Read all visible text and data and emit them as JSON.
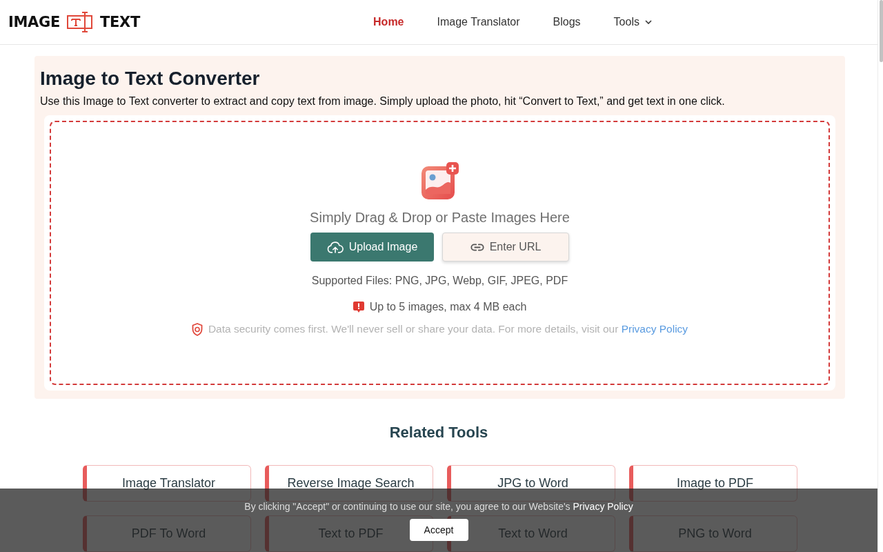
{
  "header": {
    "logo": {
      "left": "IMAGE",
      "right": "TEXT"
    },
    "nav": [
      {
        "label": "Home",
        "selected": true,
        "kind": "link"
      },
      {
        "label": "Image Translator",
        "selected": false,
        "kind": "link"
      },
      {
        "label": "Blogs",
        "selected": false,
        "kind": "link"
      },
      {
        "label": "Tools",
        "selected": false,
        "kind": "dropdown"
      }
    ]
  },
  "converter": {
    "title": "Image to Text Converter",
    "description": "Use this Image to Text converter to extract and copy text from image. Simply upload the photo, hit “Convert to Text,” and get text in one click.",
    "drop_zone": {
      "prompt": "Simply Drag & Drop or Paste Images Here",
      "buttons": [
        {
          "label": "Upload Image",
          "kind": "primary"
        },
        {
          "label": "Enter URL",
          "kind": "secondary"
        }
      ],
      "supported": "Supported Files: PNG, JPG, Webp, GIF, JPEG, PDF",
      "limit": "Up to 5 images, max 4 MB each",
      "security": {
        "text": "Data security comes first. We'll never sell or share your data. For more details, visit our",
        "link": "Privacy Policy"
      }
    }
  },
  "related_tools": {
    "title": "Related Tools",
    "items": [
      "Image Translator",
      "Reverse Image Search",
      "JPG to Word",
      "Image to PDF",
      "PDF To Word",
      "Text to PDF",
      "Text to Word",
      "PNG to Word"
    ]
  },
  "cookie_banner": {
    "text": "By clicking \"Accept\" or continuing to use our site, you agree to our Website's",
    "link": "Privacy Policy",
    "button": "Accept"
  }
}
